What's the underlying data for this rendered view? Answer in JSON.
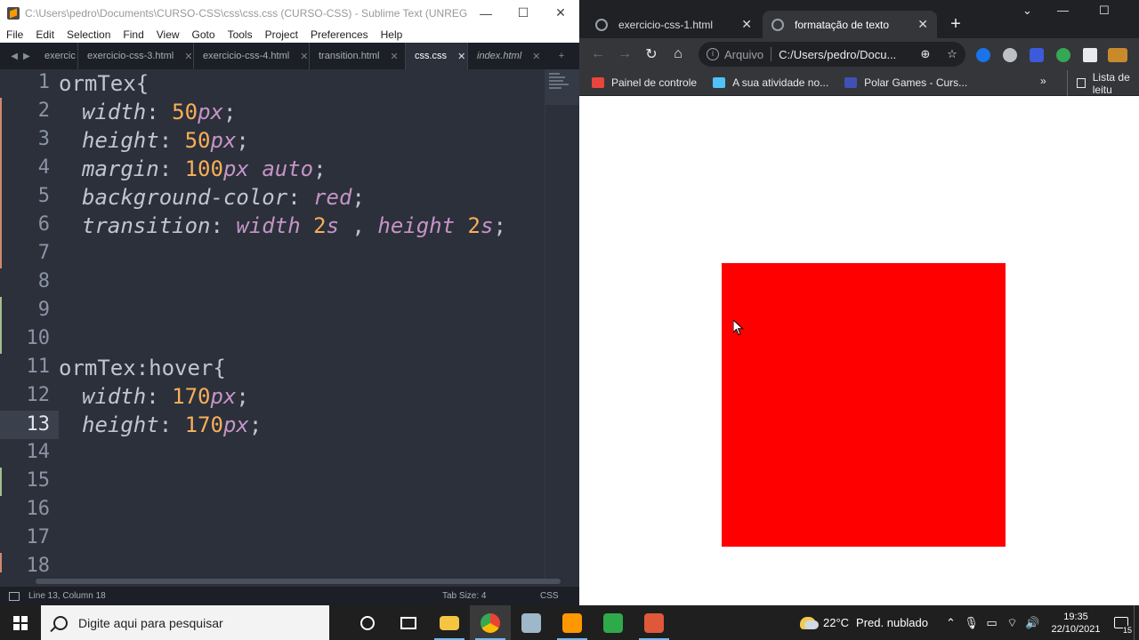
{
  "sublime": {
    "title": "C:\\Users\\pedro\\Documents\\CURSO-CSS\\css\\css.css (CURSO-CSS) - Sublime Text (UNREGISTERED)",
    "menu": [
      "File",
      "Edit",
      "Selection",
      "Find",
      "View",
      "Goto",
      "Tools",
      "Project",
      "Preferences",
      "Help"
    ],
    "tabs": [
      {
        "label": "exercic",
        "active": false
      },
      {
        "label": "exercicio-css-3.html",
        "active": false
      },
      {
        "label": "exercicio-css-4.html",
        "active": false
      },
      {
        "label": "transition.html",
        "active": false
      },
      {
        "label": "css.css",
        "active": true
      },
      {
        "label": "index.html",
        "active": false
      }
    ],
    "line_numbers": [
      "1",
      "2",
      "3",
      "4",
      "5",
      "6",
      "7",
      "8",
      "9",
      "10",
      "11",
      "12",
      "13",
      "14",
      "15",
      "16",
      "17",
      "18"
    ],
    "current_line": "13",
    "code": {
      "l1_sel": "ormTex",
      "l1_brace": "{",
      "l2_prop": "width",
      "l2_num": "50",
      "l2_unit": "px",
      "l3_prop": "height",
      "l3_num": "50",
      "l3_unit": "px",
      "l4_prop": "margin",
      "l4_num": "100",
      "l4_unit": "px",
      "l4_kw": "auto",
      "l5_prop": "background-color",
      "l5_kw": "red",
      "l6_prop": "transition",
      "l6_kw1": "width",
      "l6_num1": "2",
      "l6_unit1": "s",
      "l6_kw2": "height",
      "l6_num2": "2",
      "l6_unit2": "s",
      "l11_sel": "ormTex",
      "l11_pseudo": "hover",
      "l11_brace": "{",
      "l12_prop": "width",
      "l12_num": "170",
      "l12_unit": "px",
      "l13_prop": "height",
      "l13_num": "170",
      "l13_unit": "px"
    },
    "status": {
      "position": "Line 13, Column 18",
      "tab_size": "Tab Size: 4",
      "syntax": "CSS"
    }
  },
  "chrome": {
    "tabs": [
      {
        "label": "exercicio-css-1.html",
        "active": false
      },
      {
        "label": "formatação de texto",
        "active": true
      }
    ],
    "omnibox": {
      "scheme": "Arquivo",
      "url": "C:/Users/pedro/Docu..."
    },
    "bookmarks": [
      {
        "label": "Painel de controle",
        "color": "#e8453c"
      },
      {
        "label": "A sua atividade no...",
        "color": "#4fc3f7"
      },
      {
        "label": "Polar Games - Curs...",
        "color": "#3f51b5"
      }
    ],
    "reading_list": "Lista de leitu",
    "page": {
      "box_color": "#ff0000"
    }
  },
  "taskbar": {
    "search_placeholder": "Digite aqui para pesquisar",
    "weather_temp": "22°C",
    "weather_desc": "Pred. nublado",
    "time": "19:35",
    "date": "22/10/2021",
    "notification_count": "15"
  }
}
